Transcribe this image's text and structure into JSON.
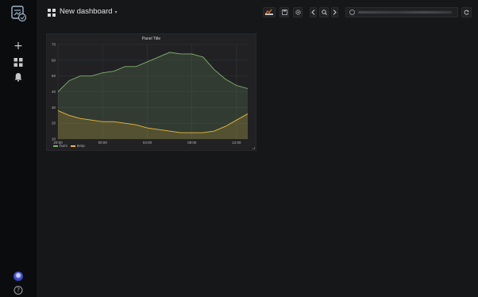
{
  "sidebar": {
    "logo": "grafana-logo-icon",
    "items": [
      {
        "icon": "plus-icon"
      },
      {
        "icon": "dashboards-icon"
      },
      {
        "icon": "bell-icon"
      }
    ],
    "bottom": [
      {
        "icon": "avatar-icon"
      },
      {
        "icon": "help-icon",
        "glyph": "?"
      }
    ]
  },
  "topbar": {
    "dashboard_title": "New dashboard",
    "caret": "▾",
    "buttons": [
      "add-panel-icon",
      "save-icon",
      "settings-icon",
      "chevron-left-icon",
      "zoom-out-icon",
      "chevron-right-icon",
      "refresh-icon"
    ]
  },
  "panel": {
    "title": "Panel Title",
    "legend": [
      {
        "name": "humi",
        "color": "#7eb26d"
      },
      {
        "name": "temp",
        "color": "#eab839"
      }
    ]
  },
  "chart_data": {
    "type": "area",
    "title": "Panel Title",
    "x": [
      "20:00",
      "21:00",
      "22:00",
      "23:00",
      "00:00",
      "01:00",
      "02:00",
      "03:00",
      "04:00",
      "05:00",
      "06:00",
      "07:00",
      "08:00",
      "09:00",
      "10:00",
      "11:00",
      "12:00",
      "13:00"
    ],
    "xticks": [
      "20:00",
      "00:00",
      "04:00",
      "08:00",
      "12:00"
    ],
    "ylim": [
      10,
      70
    ],
    "yticks": [
      10,
      20,
      30,
      40,
      50,
      60,
      70
    ],
    "grid": true,
    "legend_position": "bottom-left",
    "series": [
      {
        "name": "humi",
        "color": "#7eb26d",
        "values": [
          40,
          47,
          50,
          50,
          52,
          53,
          56,
          56,
          59,
          62,
          65,
          64,
          64,
          62,
          54,
          48,
          44,
          42
        ]
      },
      {
        "name": "temp",
        "color": "#eab839",
        "values": [
          28,
          25,
          23,
          22,
          21,
          21,
          20,
          19,
          17,
          16,
          15,
          14,
          14,
          14,
          15,
          18,
          22,
          26
        ]
      }
    ]
  }
}
